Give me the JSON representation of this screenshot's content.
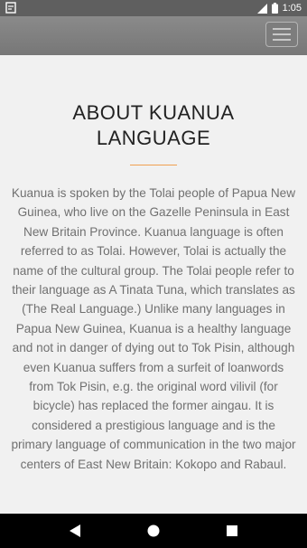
{
  "status_bar": {
    "time": "1:05"
  },
  "app_bar": {
    "menu_icon": "hamburger-menu-icon"
  },
  "content": {
    "title": "ABOUT KUANUA LANGUAGE",
    "accent_color": "#f0a050",
    "body": "Kuanua is spoken by the Tolai people of Papua New Guinea, who live on the Gazelle Peninsula in East New Britain Province. Kuanua language is often referred to as Tolai. However, Tolai is actually the name of the cultural group. The Tolai people refer to their language as A Tinata Tuna, which translates as (The Real Language.) Unlike many languages in Papua New Guinea, Kuanua is a healthy language and not in danger of dying out to Tok Pisin, although even Kuanua suffers from a surfeit of loanwords from Tok Pisin, e.g. the original word vilivil (for bicycle) has replaced the former aingau. It is considered a prestigious language and is the primary language of communication in the two major centers of East New Britain: Kokopo and Rabaul."
  },
  "nav_bar": {
    "back_icon": "back-triangle-icon",
    "home_icon": "home-circle-icon",
    "recents_icon": "recents-square-icon"
  }
}
